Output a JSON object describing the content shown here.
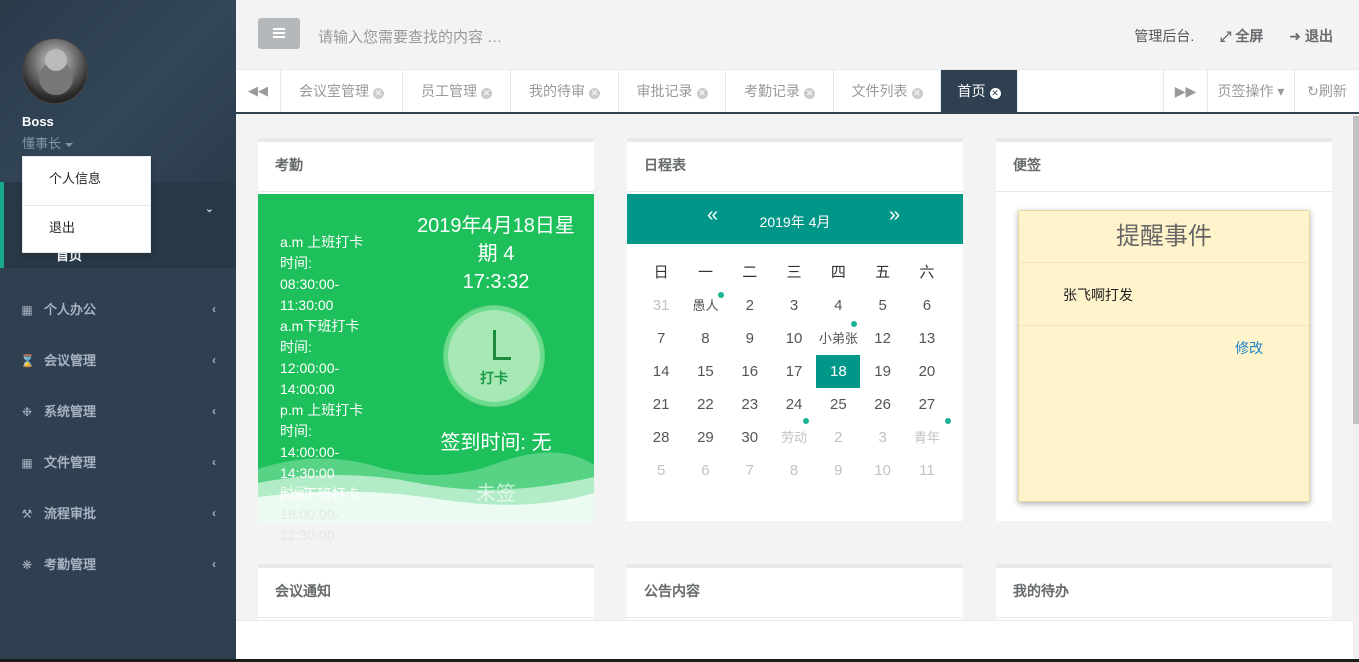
{
  "sidebar": {
    "user": {
      "name": "Boss",
      "role": "懂事长"
    },
    "dropdown": [
      "个人信息",
      "退出"
    ],
    "home_label": "首页",
    "items": [
      {
        "icon": "calendar-icon",
        "label": "个人办公"
      },
      {
        "icon": "hourglass-icon",
        "label": "会议管理"
      },
      {
        "icon": "gear-icon",
        "label": "系统管理"
      },
      {
        "icon": "file-icon",
        "label": "文件管理"
      },
      {
        "icon": "gavel-icon",
        "label": "流程审批"
      },
      {
        "icon": "gears-icon",
        "label": "考勤管理"
      }
    ]
  },
  "topbar": {
    "search_placeholder": "请输入您需要查找的内容 …",
    "admin_label": "管理后台.",
    "fullscreen_label": "全屏",
    "logout_label": "退出"
  },
  "tabs": {
    "items": [
      "会议室管理",
      "员工管理",
      "我的待审",
      "审批记录",
      "考勤记录",
      "文件列表",
      "首页"
    ],
    "active": "首页",
    "page_ops_label": "页签操作",
    "refresh_label": "刷新"
  },
  "attendance": {
    "title": "考勤",
    "schedule": [
      "a.m 上班打卡",
      "时间:",
      "08:30:00-",
      "11:30:00",
      "a.m下班打卡",
      "时间:",
      "12:00:00-",
      "14:00:00",
      "p.m 上班打卡",
      "时间:",
      "14:00:00-",
      "14:30:00",
      "p.m下班打卡",
      "时间:",
      "18:00:00-",
      "22:30:00"
    ],
    "date_line1": "2019年4月18日星",
    "date_line2": "期 4",
    "time": "17:3:32",
    "punch_label": "打卡",
    "signin_label": "签到时间: 无",
    "status_label": "未签"
  },
  "calendar": {
    "title": "日程表",
    "prev": "«",
    "next": "»",
    "year_month": "2019年  4月",
    "weekdays": [
      "日",
      "一",
      "二",
      "三",
      "四",
      "五",
      "六"
    ],
    "rows": [
      [
        "31",
        "愚人",
        "2",
        "3",
        "4",
        "5",
        "6"
      ],
      [
        "7",
        "8",
        "9",
        "10",
        "小弟张",
        "12",
        "13"
      ],
      [
        "14",
        "15",
        "16",
        "17",
        "18",
        "19",
        "20"
      ],
      [
        "21",
        "22",
        "23",
        "24",
        "25",
        "26",
        "27"
      ],
      [
        "28",
        "29",
        "30",
        "劳动",
        "2",
        "3",
        "青年"
      ],
      [
        "5",
        "6",
        "7",
        "8",
        "9",
        "10",
        "11"
      ]
    ],
    "today": "18"
  },
  "note": {
    "title": "便签",
    "heading": "提醒事件",
    "content": "张飞啊打发",
    "edit_label": "修改"
  },
  "bottom_panels": [
    "会议通知",
    "公告内容",
    "我的待办"
  ],
  "colors": {
    "sidebar": "#2f4050",
    "accent": "#009688",
    "attendance_green": "#1ec05c",
    "note_bg": "#fff3cc"
  }
}
